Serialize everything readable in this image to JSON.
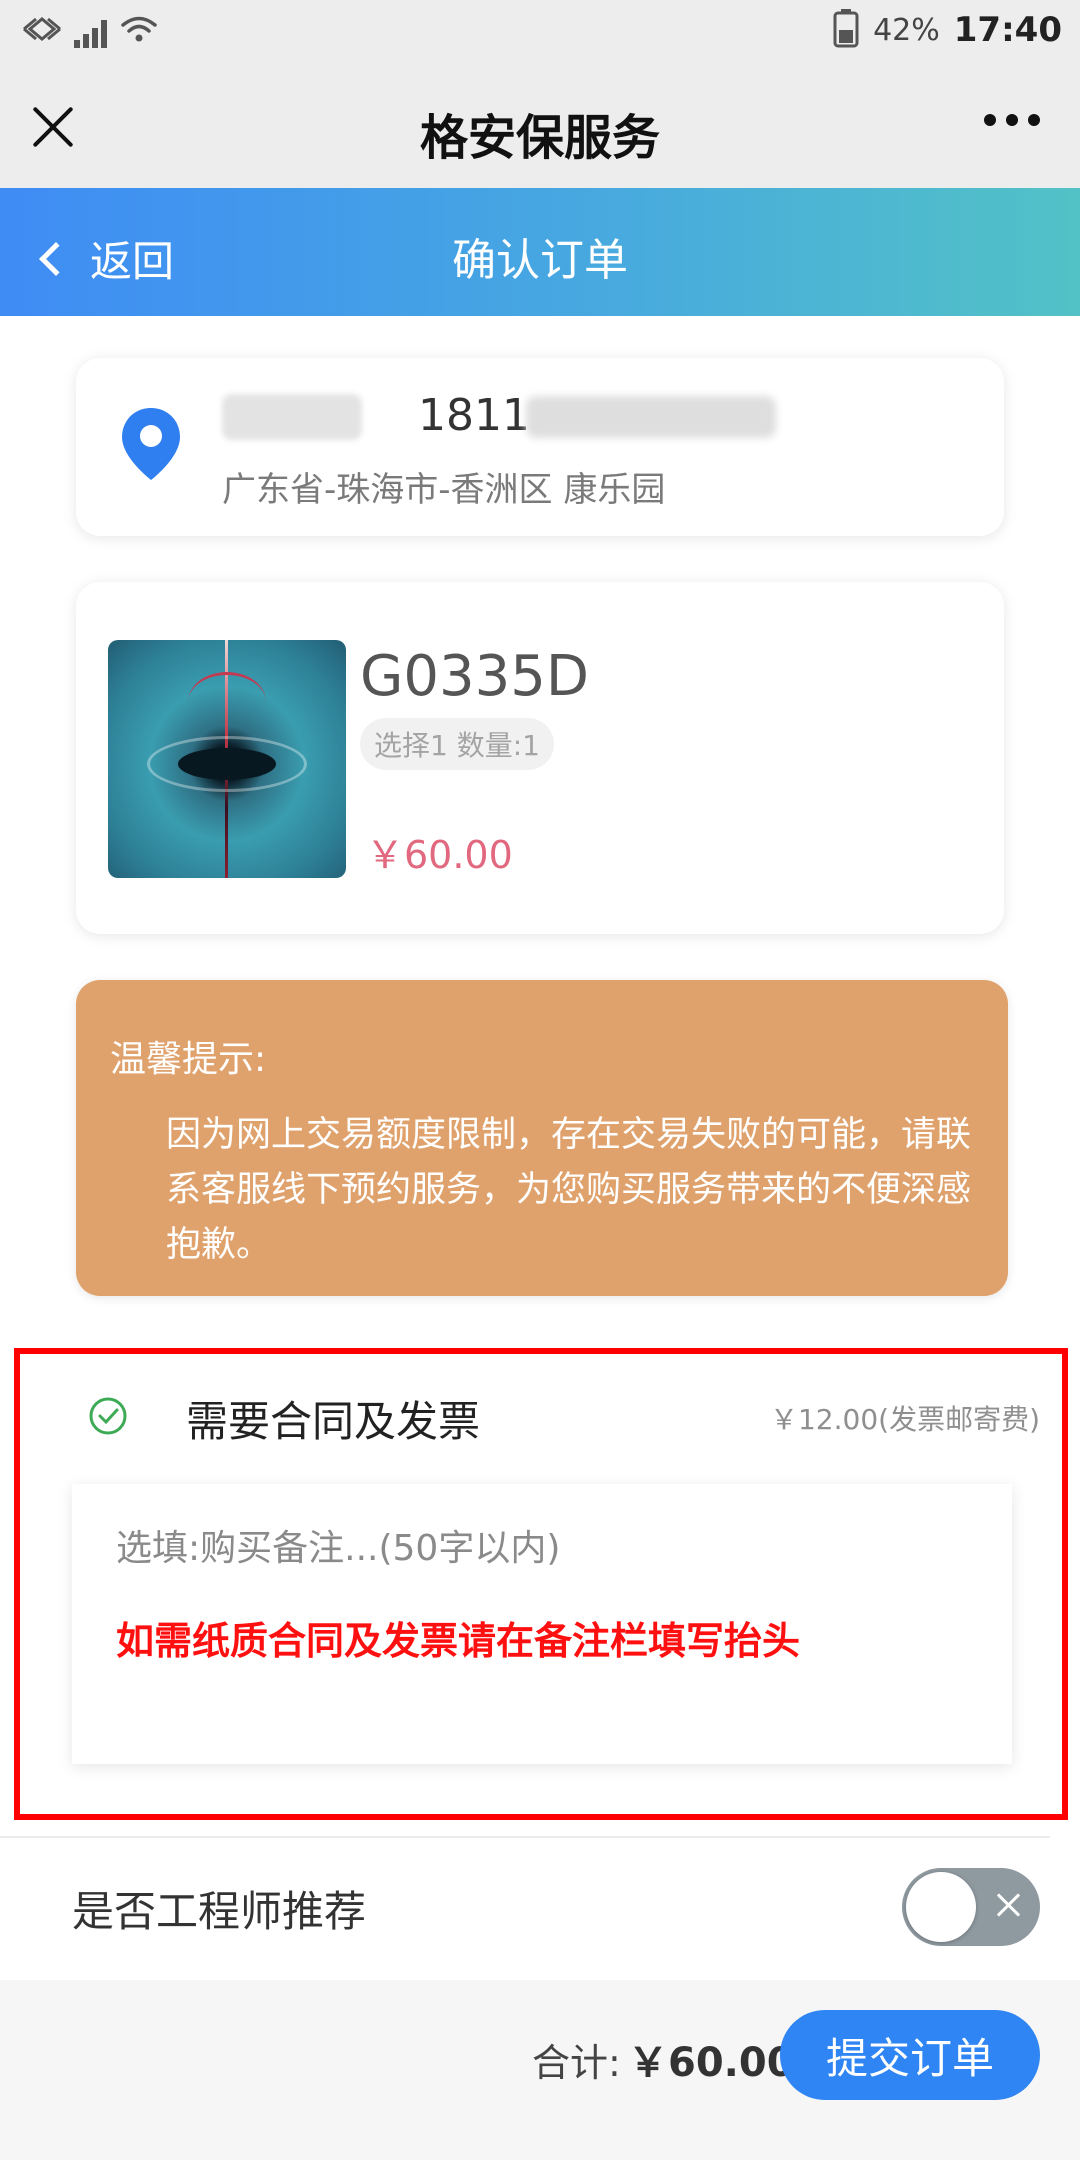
{
  "status_bar": {
    "battery": "42%",
    "time": "17:40"
  },
  "window": {
    "title": "格安保服务"
  },
  "nav": {
    "back_label": "返回",
    "title": "确认订单"
  },
  "address": {
    "phone_prefix": "1811",
    "location": "广东省-珠海市-香洲区 康乐园"
  },
  "product": {
    "name": "G0335D",
    "spec": "选择1 数量:1",
    "price": "￥60.00"
  },
  "tip": {
    "title": "温馨提示:",
    "body": "因为网上交易额度限制，存在交易失败的可能，请联系客服线下预约服务，为您购买服务带来的不便深感抱歉。"
  },
  "invoice": {
    "label": "需要合同及发票",
    "fee": "￥12.00(发票邮寄费)",
    "remark_placeholder": "选填:购买备注...(50字以内)",
    "remark_note": "如需纸质合同及发票请在备注栏填写抬头"
  },
  "engineer": {
    "label": "是否工程师推荐",
    "enabled": false
  },
  "footer": {
    "total_label": "合计:",
    "total_value": "￥60.00",
    "submit_label": "提交订单"
  },
  "colors": {
    "accent_blue": "#2f85f3",
    "tip_orange": "#e0a26c",
    "price_pink": "#e1687e",
    "highlight_red": "#ff0000"
  }
}
